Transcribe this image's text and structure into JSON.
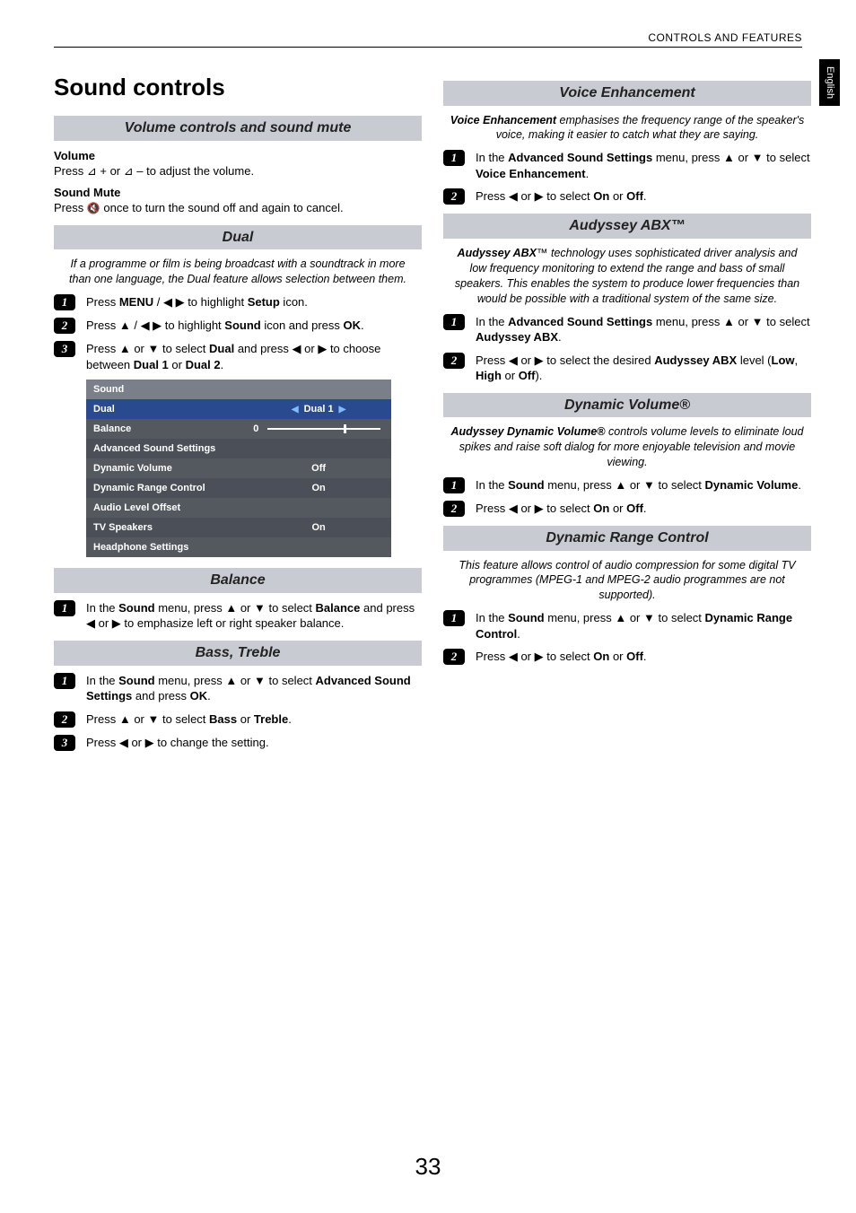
{
  "header": {
    "breadcrumb": "CONTROLS AND FEATURES",
    "language": "English"
  },
  "page_number": "33",
  "col_left": {
    "title": "Sound controls",
    "section_volume": {
      "header": "Volume controls and sound mute",
      "vol_label": "Volume",
      "vol_text_pre": "Press ",
      "vol_text_mid": " + or ",
      "vol_text_post": " – to adjust the volume.",
      "mute_label": "Sound Mute",
      "mute_text_pre": "Press ",
      "mute_text_post": " once to turn the sound off and again to cancel."
    },
    "section_dual": {
      "header": "Dual",
      "intro": "If a programme or film is being broadcast with a soundtrack in more than one language, the Dual feature allows selection between them.",
      "step1_pre": "Press ",
      "step1_menu": "MENU",
      "step1_mid": " / ",
      "step1_post": " to highlight ",
      "step1_setup": "Setup",
      "step1_end": " icon.",
      "step2_pre": "Press ",
      "step2_mid": " / ",
      "step2_post": " to highlight ",
      "step2_sound": "Sound",
      "step2_end": " icon and press ",
      "step2_ok": "OK",
      "step2_dot": ".",
      "step3_pre": "Press ",
      "step3_or": " or ",
      "step3_mid": " to select ",
      "step3_dual": "Dual",
      "step3_and": " and press ",
      "step3_or2": " or ",
      "step3_post": " to choose between ",
      "step3_d1": "Dual 1",
      "step3_or3": " or ",
      "step3_d2": "Dual 2",
      "step3_dot": "."
    },
    "menu_table": {
      "title": "Sound",
      "rows": [
        {
          "label": "Dual",
          "value": "Dual 1",
          "highlight": true,
          "arrows": true
        },
        {
          "label": "Balance",
          "value": "0",
          "slider": true
        },
        {
          "label": "Advanced Sound Settings",
          "value": ""
        },
        {
          "label": "Dynamic Volume",
          "value": "Off"
        },
        {
          "label": "Dynamic Range Control",
          "value": "On"
        },
        {
          "label": "Audio Level Offset",
          "value": ""
        },
        {
          "label": "TV Speakers",
          "value": "On"
        },
        {
          "label": "Headphone Settings",
          "value": ""
        }
      ]
    },
    "section_balance": {
      "header": "Balance",
      "step1_pre": "In the ",
      "step1_sound": "Sound",
      "step1_mid": " menu, press ",
      "step1_or": " or ",
      "step1_sel": " to select ",
      "step1_bal": "Balance",
      "step1_and": " and press ",
      "step1_or2": " or ",
      "step1_end": " to emphasize left or right speaker balance."
    },
    "section_bass": {
      "header": "Bass, Treble",
      "step1_pre": "In the ",
      "step1_sound": "Sound",
      "step1_mid": " menu, press ",
      "step1_or": " or ",
      "step1_sel": " to select ",
      "step1_adv": "Advanced Sound Settings",
      "step1_and": " and press ",
      "step1_ok": "OK",
      "step1_dot": ".",
      "step2_pre": "Press ",
      "step2_or": " or ",
      "step2_sel": " to select ",
      "step2_bass": "Bass",
      "step2_or2": " or ",
      "step2_treble": "Treble",
      "step2_dot": ".",
      "step3_pre": "Press ",
      "step3_or": " or ",
      "step3_end": " to change the setting."
    }
  },
  "col_right": {
    "section_voice": {
      "header": "Voice Enhancement",
      "intro_bold": "Voice Enhancement",
      "intro_rest": " emphasises the frequency range of the speaker's voice, making it easier to catch what they are saying.",
      "step1_pre": "In the ",
      "step1_adv": "Advanced Sound Settings",
      "step1_mid": " menu, press ",
      "step1_or": " or ",
      "step1_sel": " to select ",
      "step1_ve": "Voice Enhancement",
      "step1_dot": ".",
      "step2_pre": "Press ",
      "step2_or": " or ",
      "step2_sel": " to select ",
      "step2_on": "On",
      "step2_or2": " or ",
      "step2_off": "Off",
      "step2_dot": "."
    },
    "section_abx": {
      "header": "Audyssey ABX™",
      "intro_bold": "Audyssey ABX",
      "intro_tm": "™",
      "intro_rest": " technology uses sophisticated driver analysis and low frequency monitoring to extend the range and bass of small speakers. This enables the system to produce lower frequencies than would be possible with a traditional system of the same size.",
      "step1_pre": "In the ",
      "step1_adv": "Advanced Sound Settings",
      "step1_mid": " menu, press ",
      "step1_or": " or ",
      "step1_sel": " to select ",
      "step1_abx": "Audyssey ABX",
      "step1_dot": ".",
      "step2_pre": "Press ",
      "step2_or": " or ",
      "step2_sel": " to select the desired ",
      "step2_abx": "Audyssey ABX",
      "step2_lvl": " level (",
      "step2_low": "Low",
      "step2_c1": ", ",
      "step2_high": "High",
      "step2_or2": " or ",
      "step2_off": "Off",
      "step2_end": ")."
    },
    "section_dynvol": {
      "header": "Dynamic Volume®",
      "intro_bold": "Audyssey Dynamic Volume®",
      "intro_rest": " controls volume levels to eliminate loud spikes and raise soft dialog for more enjoyable television and movie viewing.",
      "step1_pre": "In the ",
      "step1_sound": "Sound",
      "step1_mid": " menu, press ",
      "step1_or": " or ",
      "step1_sel": " to select ",
      "step1_dv": "Dynamic Volume",
      "step1_dot": ".",
      "step2_pre": "Press ",
      "step2_or": " or ",
      "step2_sel": " to select ",
      "step2_on": "On",
      "step2_or2": " or ",
      "step2_off": "Off",
      "step2_dot": "."
    },
    "section_drc": {
      "header": "Dynamic Range Control",
      "intro": "This feature allows control of audio compression for some digital TV programmes (MPEG-1 and MPEG-2 audio programmes are not supported).",
      "step1_pre": "In the ",
      "step1_sound": "Sound",
      "step1_mid": " menu, press ",
      "step1_or": " or ",
      "step1_sel": " to select ",
      "step1_drc": "Dynamic Range Control",
      "step1_dot": ".",
      "step2_pre": "Press ",
      "step2_or": " or ",
      "step2_sel": " to select ",
      "step2_on": "On",
      "step2_or2": " or ",
      "step2_off": "Off",
      "step2_dot": "."
    }
  }
}
